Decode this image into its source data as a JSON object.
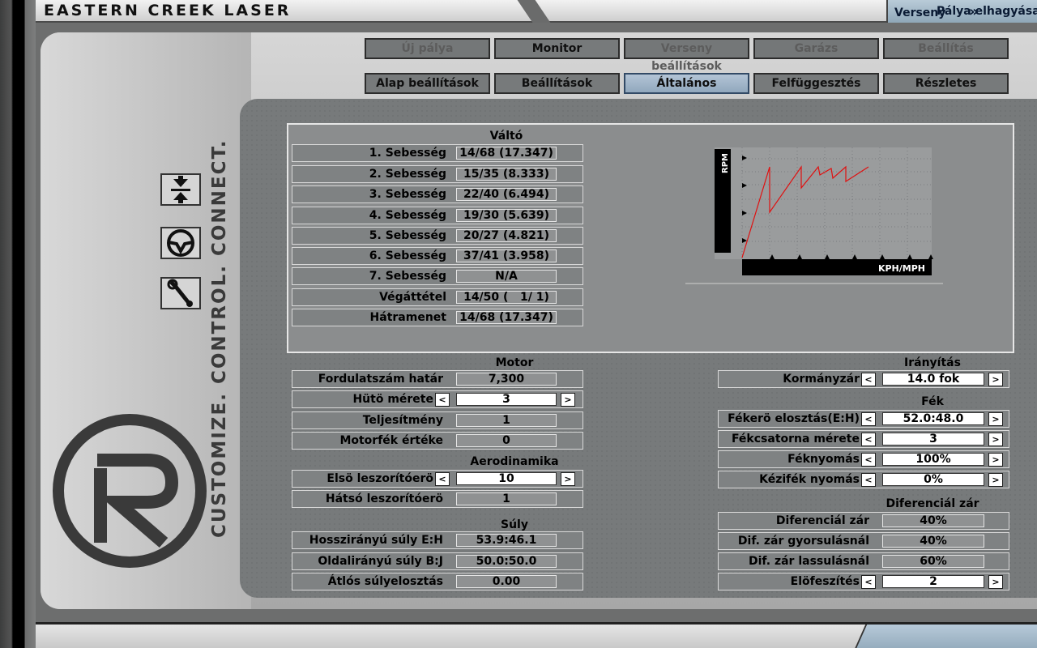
{
  "app": {
    "title": "EASTERN CREEK LASER",
    "leave_label": "Pálya elhagyása",
    "leave_icon": "close-icon"
  },
  "nav_top": [
    {
      "label": "Új pálya",
      "state": "disabled"
    },
    {
      "label": "Monitor",
      "state": "normal"
    },
    {
      "label": "Verseny beállítások",
      "state": "disabled"
    },
    {
      "label": "Garázs",
      "state": "disabled"
    },
    {
      "label": "Beállítás",
      "state": "disabled"
    }
  ],
  "nav_sub": [
    {
      "label": "Alap beállítások",
      "state": "normal"
    },
    {
      "label": "Beállítások",
      "state": "normal"
    },
    {
      "label": "Általános",
      "state": "active"
    },
    {
      "label": "Felfüggesztés",
      "state": "normal"
    },
    {
      "label": "Részletes",
      "state": "normal"
    }
  ],
  "sidebar_icons": [
    "arrows-up-down-icon",
    "steering-wheel-icon",
    "wrench-icon"
  ],
  "brand_text": "CUSTOMIZE. CONTROL. CONNECT.",
  "gearbox": {
    "title": "Váltó",
    "rows": [
      {
        "label": "1. Sebesség",
        "value": "14/68 (17.347)"
      },
      {
        "label": "2. Sebesség",
        "value": "15/35 (8.333)"
      },
      {
        "label": "3. Sebesség",
        "value": "22/40 (6.494)"
      },
      {
        "label": "4. Sebesség",
        "value": "19/30 (5.639)"
      },
      {
        "label": "5. Sebesség",
        "value": "20/27 (4.821)"
      },
      {
        "label": "6. Sebesség",
        "value": "37/41 (3.958)"
      },
      {
        "label": "7. Sebesség",
        "value": "N/A"
      },
      {
        "label": "Végáttétel",
        "value": "14/50 (   1/ 1)"
      },
      {
        "label": "Hátramenet",
        "value": "14/68 (17.347)"
      }
    ]
  },
  "gear_chart": {
    "y_label": "RPM",
    "x_label": "KPH/MPH",
    "line_color": "#e01010"
  },
  "engine": {
    "title": "Motor",
    "rows": [
      {
        "label": "Fordulatszám határ",
        "value": "7,300",
        "editable": false
      },
      {
        "label": "Hütö mérete",
        "value": "3",
        "editable": true
      },
      {
        "label": "Teljesítmény",
        "value": "1",
        "editable": false
      },
      {
        "label": "Motorfék értéke",
        "value": "0",
        "editable": false
      }
    ]
  },
  "aero": {
    "title": "Aerodinamika",
    "rows": [
      {
        "label": "Elsö leszorítóerö",
        "value": "10",
        "editable": true
      },
      {
        "label": "Hátsó leszorítóerö",
        "value": "1",
        "editable": false
      }
    ]
  },
  "weight": {
    "title": "Súly",
    "rows": [
      {
        "label": "Hosszirányú súly E:H",
        "value": "53.9:46.1"
      },
      {
        "label": "Oldalirányú súly B:J",
        "value": "50.0:50.0"
      },
      {
        "label": "Átlós súlyelosztás",
        "value": "0.00"
      }
    ]
  },
  "steering": {
    "title": "Irányítás",
    "rows": [
      {
        "label": "Kormányzár",
        "value": "14.0 fok",
        "editable": true
      }
    ]
  },
  "brakes": {
    "title": "Fék",
    "rows": [
      {
        "label": "Fékerö elosztás(E:H)",
        "value": "52.0:48.0",
        "editable": true
      },
      {
        "label": "Fékcsatorna mérete",
        "value": "3",
        "editable": true
      },
      {
        "label": "Féknyomás",
        "value": "100%",
        "editable": true
      },
      {
        "label": "Kézifék nyomás",
        "value": "0%",
        "editable": true
      }
    ]
  },
  "diff": {
    "title": "Diferenciál zár",
    "rows": [
      {
        "label": "Diferenciál zár",
        "value": "40%",
        "editable": false
      },
      {
        "label": "Dif. zár gyorsulásnál",
        "value": "40%",
        "editable": false
      },
      {
        "label": "Dif. zár lassulásnál",
        "value": "60%",
        "editable": false
      },
      {
        "label": "Elöfeszítés",
        "value": "2",
        "editable": true
      }
    ]
  },
  "footer": {
    "race_label": "Verseny",
    "race_icon": "double-chevron-right-icon"
  },
  "arrows": {
    "left": "<",
    "right": ">"
  }
}
